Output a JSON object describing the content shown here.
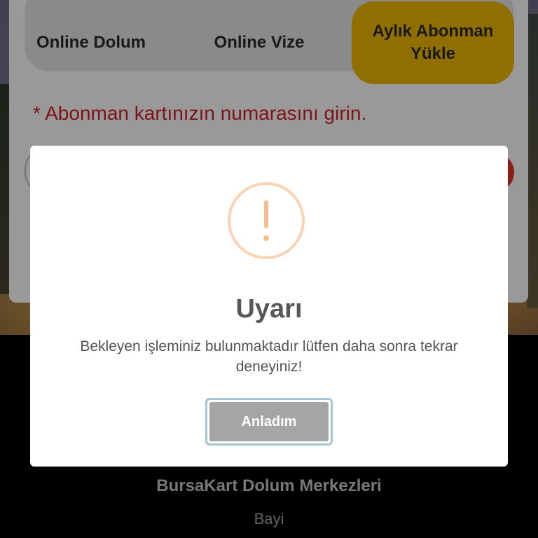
{
  "tabs": [
    {
      "label": "Online Dolum"
    },
    {
      "label": "Online Vize"
    },
    {
      "label_line1": "Aylık Abonman",
      "label_line2": "Yükle"
    }
  ],
  "form": {
    "instruction": "* Abonman kartınızın numarasını girin."
  },
  "modal": {
    "icon": "exclamation-icon",
    "title": "Uyarı",
    "message": "Bekleyen işleminiz bulunmaktadır lütfen daha sonra tekrar deneyiniz!",
    "button_label": "Anladım"
  },
  "footer": {
    "title": "BursaKart Dolum Merkezleri",
    "subtitle": "Bayi"
  },
  "colors": {
    "active_tab": "#f2b800",
    "instruction_text": "#d62028",
    "warning_icon": "#f5be8f",
    "modal_button": "#a5a5a5"
  }
}
